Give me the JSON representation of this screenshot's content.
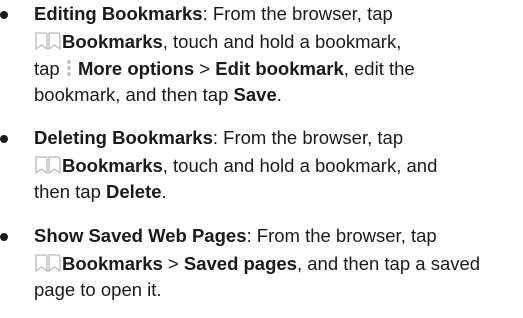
{
  "items": [
    {
      "title": "Editing Bookmarks",
      "l1_rest": ": From the browser, tap",
      "l2_label": "Bookmarks",
      "l2_rest": ", touch and hold a bookmark,",
      "l3_tap": "tap",
      "l3_more": "More options",
      "l3_sep": " > ",
      "l3_edit": "Edit bookmark",
      "l3_rest": ", edit the",
      "l4_text": "bookmark, and then tap ",
      "l4_save": "Save",
      "l4_end": "."
    },
    {
      "title": "Deleting Bookmarks",
      "l1_rest": ": From the browser, tap",
      "l2_label": "Bookmarks",
      "l2_rest": ", touch and hold a bookmark, and",
      "l3_text": "then tap ",
      "l3_delete": "Delete",
      "l3_end": "."
    },
    {
      "title": "Show Saved Web Pages",
      "l1_rest": ": From the browser, tap",
      "l2_label": "Bookmarks",
      "l2_sep": " > ",
      "l2_saved": "Saved pages",
      "l2_rest": ", and then tap a saved",
      "l3_text": "page to open it."
    }
  ],
  "icons": {
    "bookmarks": "bookmarks-icon",
    "more_options": "more-options-icon"
  }
}
